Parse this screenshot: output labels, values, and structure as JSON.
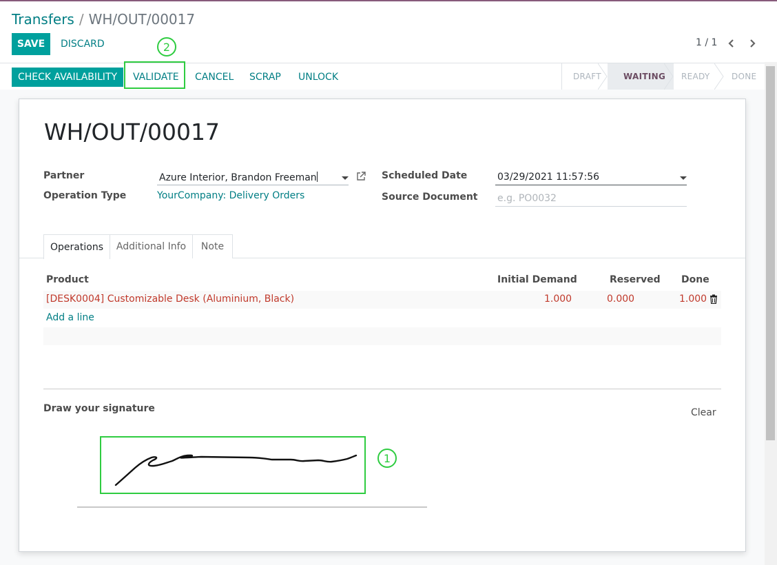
{
  "breadcrumb": {
    "parent": "Transfers",
    "separator": "/",
    "current": "WH/OUT/00017"
  },
  "toolbar": {
    "save_label": "SAVE",
    "discard_label": "DISCARD"
  },
  "pager": {
    "value": "1 / 1"
  },
  "statusbar": {
    "buttons": {
      "check": "CHECK AVAILABILITY",
      "validate": "VALIDATE",
      "cancel": "CANCEL",
      "scrap": "SCRAP",
      "unlock": "UNLOCK"
    },
    "stages": [
      "DRAFT",
      "WAITING",
      "READY",
      "DONE"
    ],
    "current_stage": "WAITING"
  },
  "record": {
    "name": "WH/OUT/00017",
    "partner_label": "Partner",
    "partner_value": "Azure Interior, Brandon Freeman",
    "operation_type_label": "Operation Type",
    "operation_type_value": "YourCompany: Delivery Orders",
    "scheduled_date_label": "Scheduled Date",
    "scheduled_date_value": "03/29/2021 11:57:56",
    "source_document_label": "Source Document",
    "source_document_placeholder": "e.g. PO0032"
  },
  "tabs": [
    "Operations",
    "Additional Info",
    "Note"
  ],
  "active_tab": "Operations",
  "operations": {
    "headers": {
      "product": "Product",
      "initial_demand": "Initial Demand",
      "reserved": "Reserved",
      "done": "Done"
    },
    "rows": [
      {
        "product": "[DESK0004] Customizable Desk (Aluminium, Black)",
        "initial_demand": "1.000",
        "reserved": "0.000",
        "done": "1.000"
      }
    ],
    "add_line": "Add a line"
  },
  "signature": {
    "label": "Draw your signature",
    "clear_label": "Clear"
  },
  "annotations": {
    "signature_marker": "1",
    "validate_marker": "2",
    "color": "#2ecc40"
  },
  "colors": {
    "primary": "#00a09d",
    "link": "#017e84",
    "brand": "#875a7b",
    "danger_text": "#c0392b"
  }
}
